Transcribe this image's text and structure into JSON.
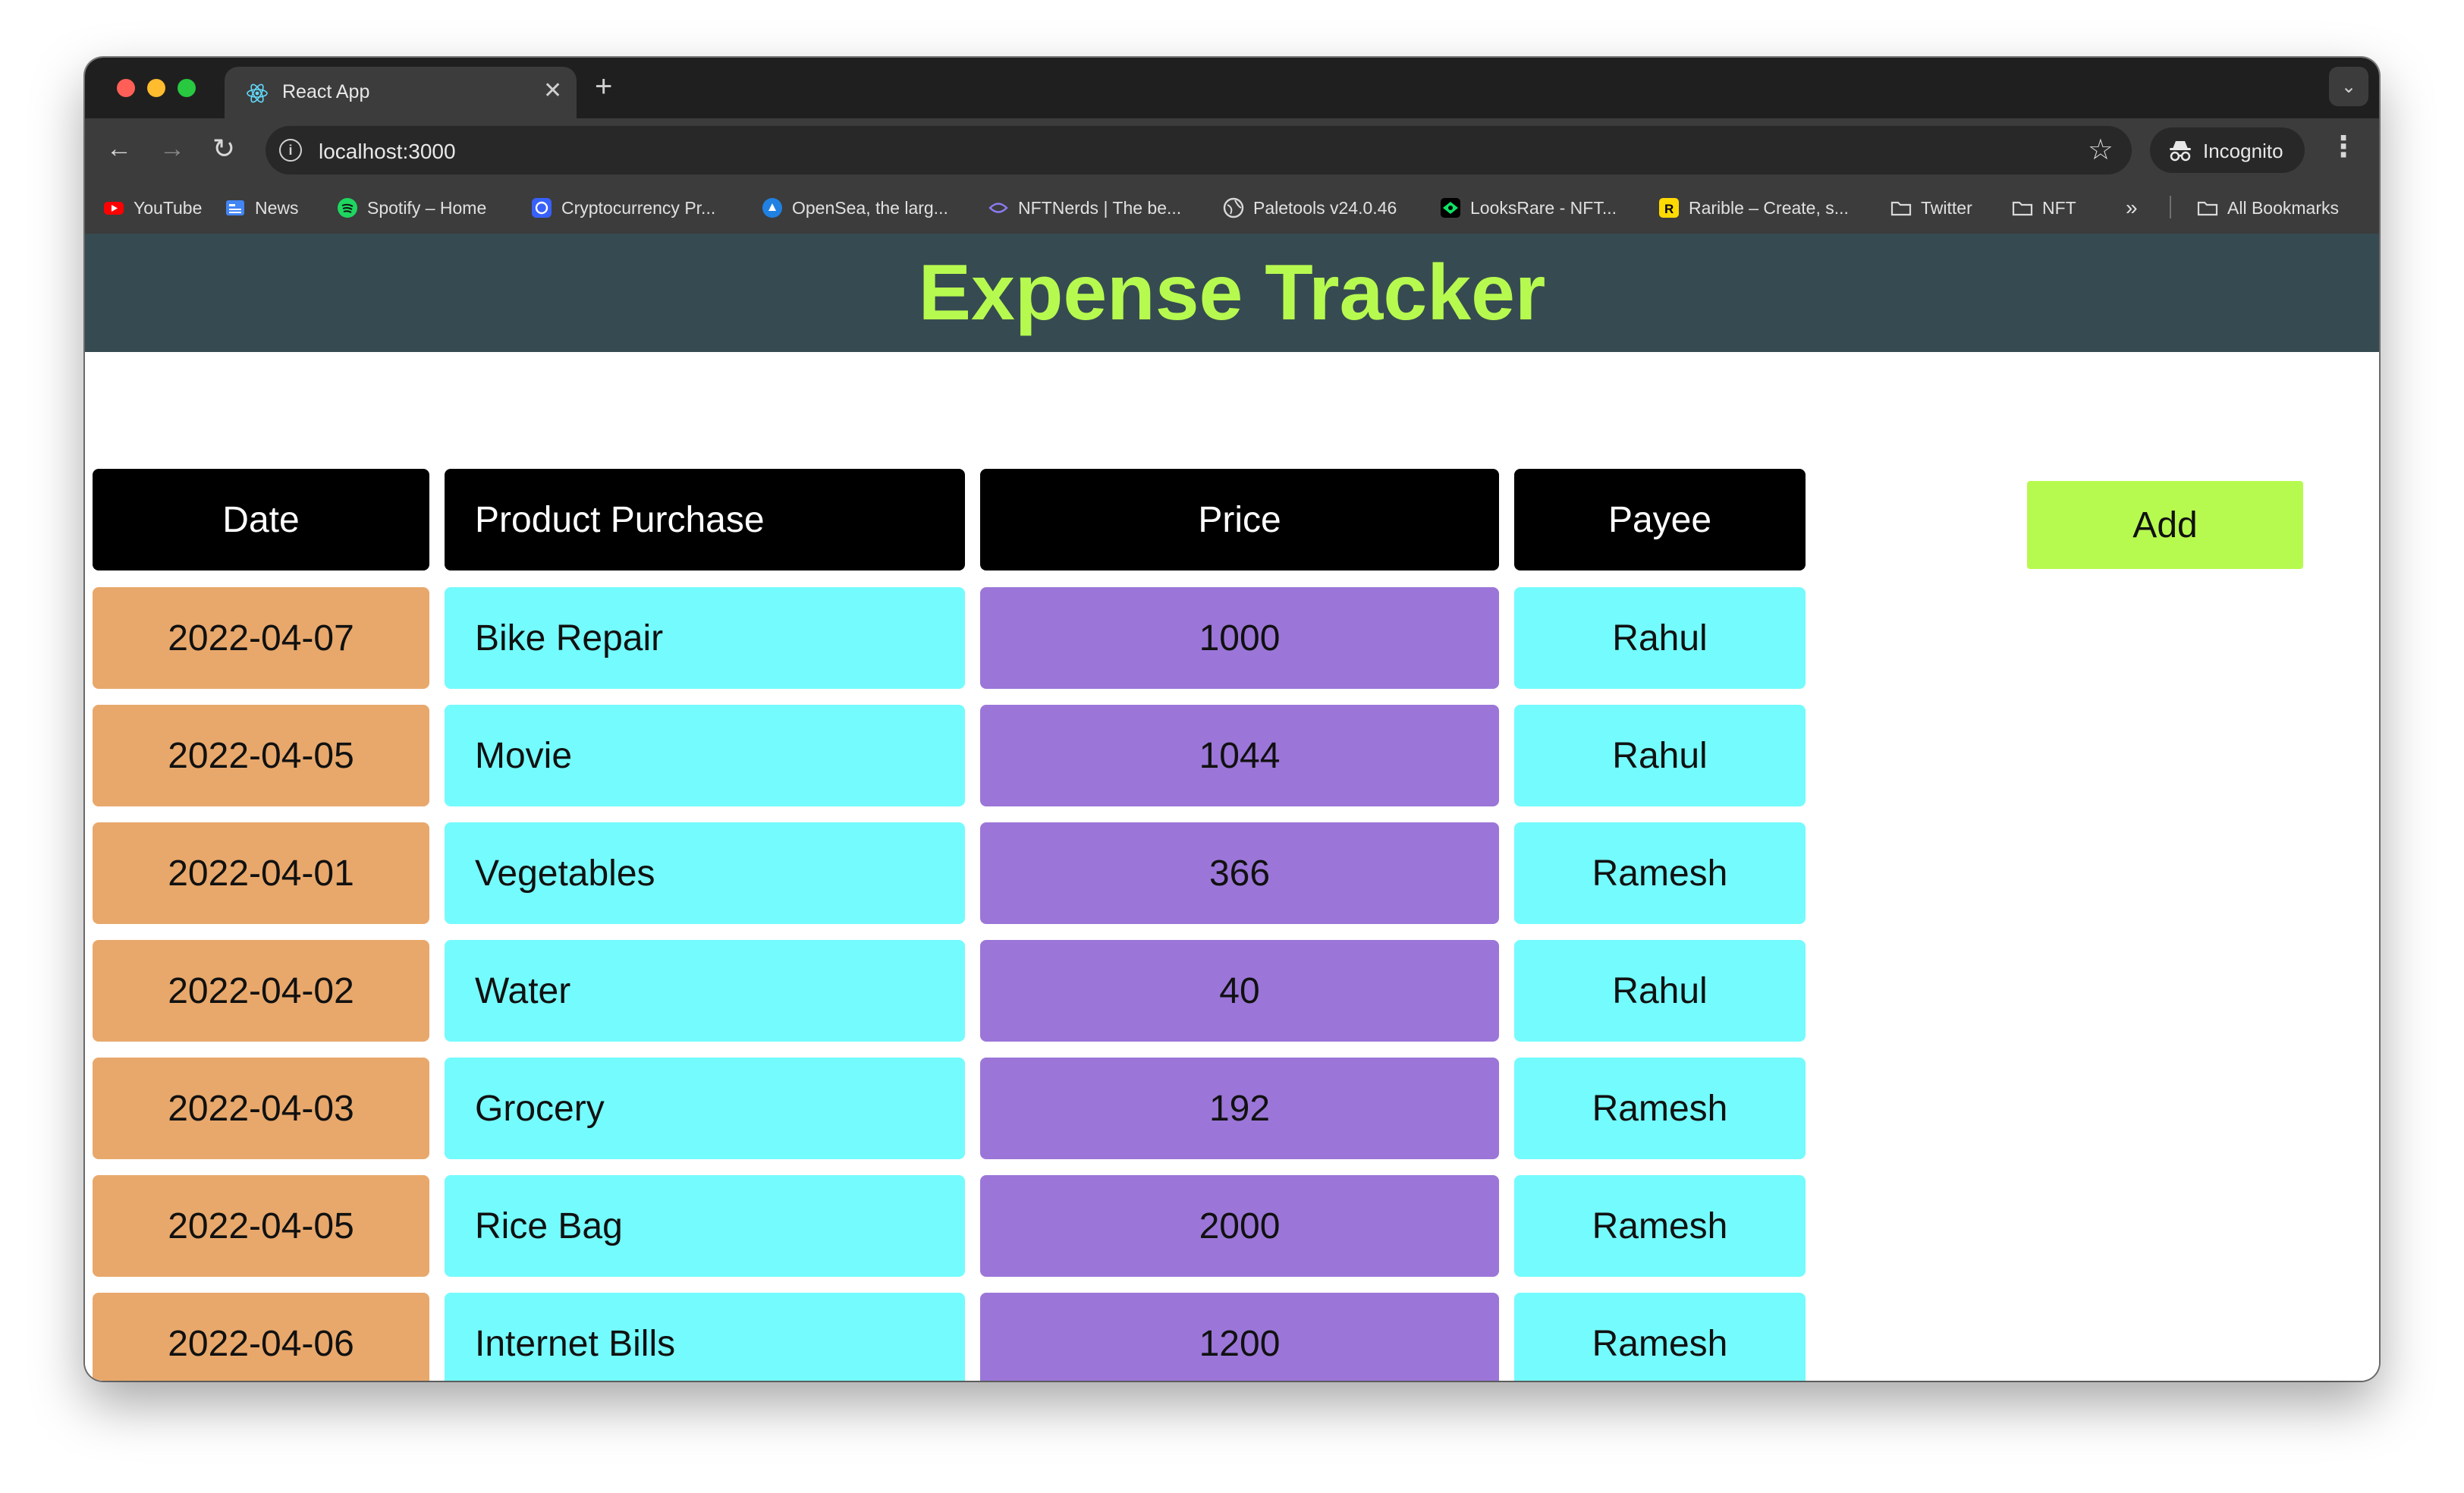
{
  "browser": {
    "tab_title": "React App",
    "url": "localhost:3000",
    "incognito_label": "Incognito",
    "bookmarks": [
      {
        "label": "YouTube",
        "icon": "youtube-icon"
      },
      {
        "label": "News",
        "icon": "google-news-icon"
      },
      {
        "label": "Spotify – Home",
        "icon": "spotify-icon"
      },
      {
        "label": "Cryptocurrency Pr...",
        "icon": "coinmarketcap-icon"
      },
      {
        "label": "OpenSea, the larg...",
        "icon": "opensea-icon"
      },
      {
        "label": "NFTNerds | The be...",
        "icon": "nftnerds-icon"
      },
      {
        "label": "Paletools v24.0.46",
        "icon": "globe-icon"
      },
      {
        "label": "LooksRare - NFT...",
        "icon": "looksrare-icon"
      },
      {
        "label": "Rarible – Create, s...",
        "icon": "rarible-icon"
      },
      {
        "label": "Twitter",
        "icon": "folder-icon"
      },
      {
        "label": "NFT",
        "icon": "folder-icon"
      },
      {
        "label": "All Bookmarks",
        "icon": "folder-icon"
      }
    ]
  },
  "app": {
    "title": "Expense Tracker",
    "add_label": "Add",
    "table": {
      "headers": [
        "Date",
        "Product Purchase",
        "Price",
        "Payee"
      ],
      "rows": [
        {
          "date": "2022-04-07",
          "product": "Bike Repair",
          "price": "1000",
          "payee": "Rahul"
        },
        {
          "date": "2022-04-05",
          "product": "Movie",
          "price": "1044",
          "payee": "Rahul"
        },
        {
          "date": "2022-04-01",
          "product": "Vegetables",
          "price": "366",
          "payee": "Ramesh"
        },
        {
          "date": "2022-04-02",
          "product": "Water",
          "price": "40",
          "payee": "Rahul"
        },
        {
          "date": "2022-04-03",
          "product": "Grocery",
          "price": "192",
          "payee": "Ramesh"
        },
        {
          "date": "2022-04-05",
          "product": "Rice Bag",
          "price": "2000",
          "payee": "Ramesh"
        },
        {
          "date": "2022-04-06",
          "product": "Internet Bills",
          "price": "1200",
          "payee": "Ramesh"
        },
        {
          "date": "",
          "product": "",
          "price": "",
          "payee": ""
        }
      ]
    },
    "colors": {
      "header_bg": "#364b51",
      "title": "#b7fa4f",
      "date_cell": "#e8a86b",
      "product_cell": "#74fbfd",
      "price_cell": "#9b76d8",
      "payee_cell": "#74fbfd",
      "add_button": "#b7fa4f"
    }
  }
}
